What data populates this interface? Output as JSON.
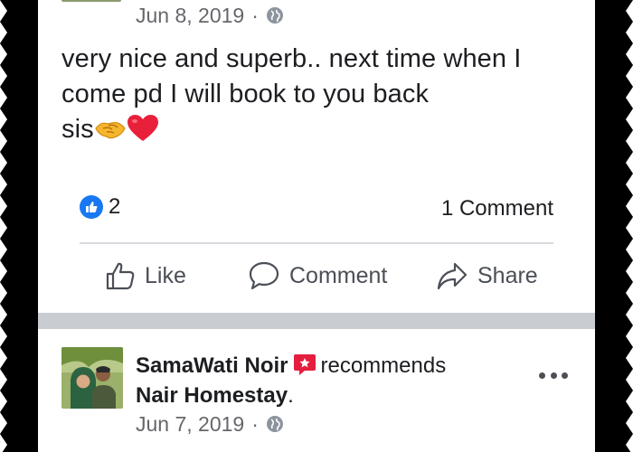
{
  "post1": {
    "date": "Jun 8, 2019",
    "separator": "·",
    "privacy_icon": "globe-icon",
    "text_lines": [
      "very nice and superb.. next time when I",
      "come pd I will book to you back",
      "sis"
    ],
    "emojis": [
      "handshake-emoji",
      "red-heart-emoji"
    ],
    "reaction_count": "2",
    "comment_count": "1 Comment",
    "actions": {
      "like": "Like",
      "comment": "Comment",
      "share": "Share"
    }
  },
  "post2": {
    "author": "SamaWati Noir",
    "verb": "recommends",
    "page": "Nair Homestay",
    "period": ".",
    "date": "Jun 7, 2019",
    "separator": "·",
    "privacy_icon": "globe-icon",
    "more_icon": "more-dots-icon"
  },
  "colors": {
    "facebook_blue": "#1877f2",
    "text_primary": "#1c1e21",
    "text_secondary": "#65676b",
    "recommend_red": "#e41e3f"
  }
}
